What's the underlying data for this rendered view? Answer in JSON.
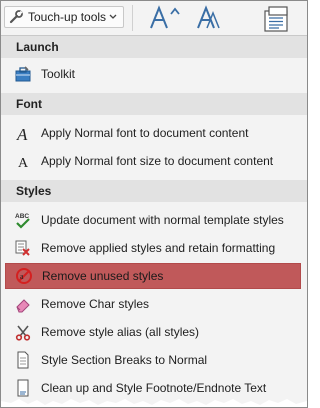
{
  "ribbon": {
    "button_label": "Touch-up tools",
    "icons": [
      "wrench-icon",
      "chevron-down-icon",
      "grow-font-icon",
      "font-style-icon",
      "document-icon"
    ]
  },
  "menu": {
    "sections": [
      {
        "header": "Launch",
        "items": [
          {
            "label": "Toolkit",
            "icon": "toolkit-icon"
          }
        ]
      },
      {
        "header": "Font",
        "items": [
          {
            "label": "Apply Normal font to document content",
            "icon": "font-a-icon"
          },
          {
            "label": "Apply Normal font size to document content",
            "icon": "font-size-a-icon"
          }
        ]
      },
      {
        "header": "Styles",
        "items": [
          {
            "label": "Update document with normal template styles",
            "icon": "abc-check-icon"
          },
          {
            "label": "Remove applied styles and retain formatting",
            "icon": "remove-format-icon"
          },
          {
            "label": "Remove unused styles",
            "icon": "no-style-icon",
            "highlighted": true
          },
          {
            "label": "Remove Char styles",
            "icon": "eraser-icon"
          },
          {
            "label": "Remove style alias (all styles)",
            "icon": "scissors-icon"
          },
          {
            "label": "Style Section Breaks to Normal",
            "icon": "page-break-icon"
          },
          {
            "label": "Clean up and Style Footnote/Endnote Text",
            "icon": "footnote-icon"
          }
        ]
      }
    ]
  },
  "colors": {
    "highlight": "#c0595a",
    "header_bg": "#e2e2e2",
    "menu_bg": "#f3f3f3"
  }
}
